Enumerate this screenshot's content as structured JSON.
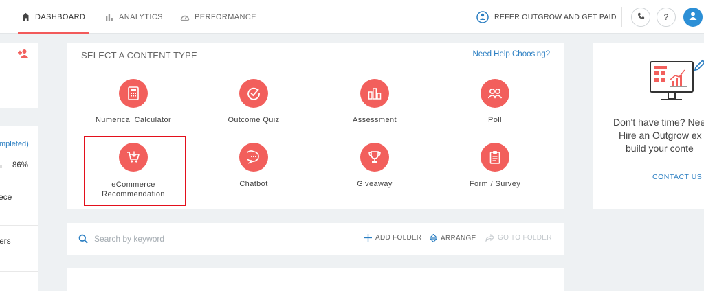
{
  "nav": {
    "tabs": [
      {
        "label": "DASHBOARD",
        "icon": "home-icon",
        "active": true
      },
      {
        "label": "ANALYTICS",
        "icon": "bar-chart-icon",
        "active": false
      },
      {
        "label": "PERFORMANCE",
        "icon": "speedometer-icon",
        "active": false
      }
    ],
    "refer_label": "REFER OUTGROW AND GET PAID",
    "phone_icon": "phone-icon",
    "help_label": "?"
  },
  "left_panel": {
    "add_user_icon": "add-user-icon",
    "status_text": "mpleted)",
    "percent": "86%",
    "row_1": "ece",
    "row_2": "ers"
  },
  "content_type": {
    "title": "SELECT A CONTENT TYPE",
    "help_link": "Need Help Choosing?",
    "items": [
      {
        "label": "Numerical Calculator",
        "icon": "calculator-icon"
      },
      {
        "label": "Outcome Quiz",
        "icon": "check-circle-icon"
      },
      {
        "label": "Assessment",
        "icon": "bar-chart-icon"
      },
      {
        "label": "Poll",
        "icon": "people-icon"
      },
      {
        "label": "eCommerce Recommendation",
        "icon": "cart-icon"
      },
      {
        "label": "Chatbot",
        "icon": "chat-icon"
      },
      {
        "label": "Giveaway",
        "icon": "trophy-icon"
      },
      {
        "label": "Form / Survey",
        "icon": "clipboard-icon"
      }
    ],
    "highlighted_item": "eCommerce Recommendation"
  },
  "search": {
    "placeholder": "Search by keyword",
    "add_folder": "ADD FOLDER",
    "arrange": "ARRANGE",
    "go_to_folder": "GO TO FOLDER"
  },
  "promo": {
    "line1": "Don't have time? Nee",
    "line2": "Hire an Outgrow ex",
    "line3": "build your conte",
    "button": "CONTACT US"
  },
  "colors": {
    "accent": "#f25f5c",
    "link": "#2a7ec2",
    "highlight_border": "#e3101c",
    "avatar": "#2c8fd6"
  }
}
